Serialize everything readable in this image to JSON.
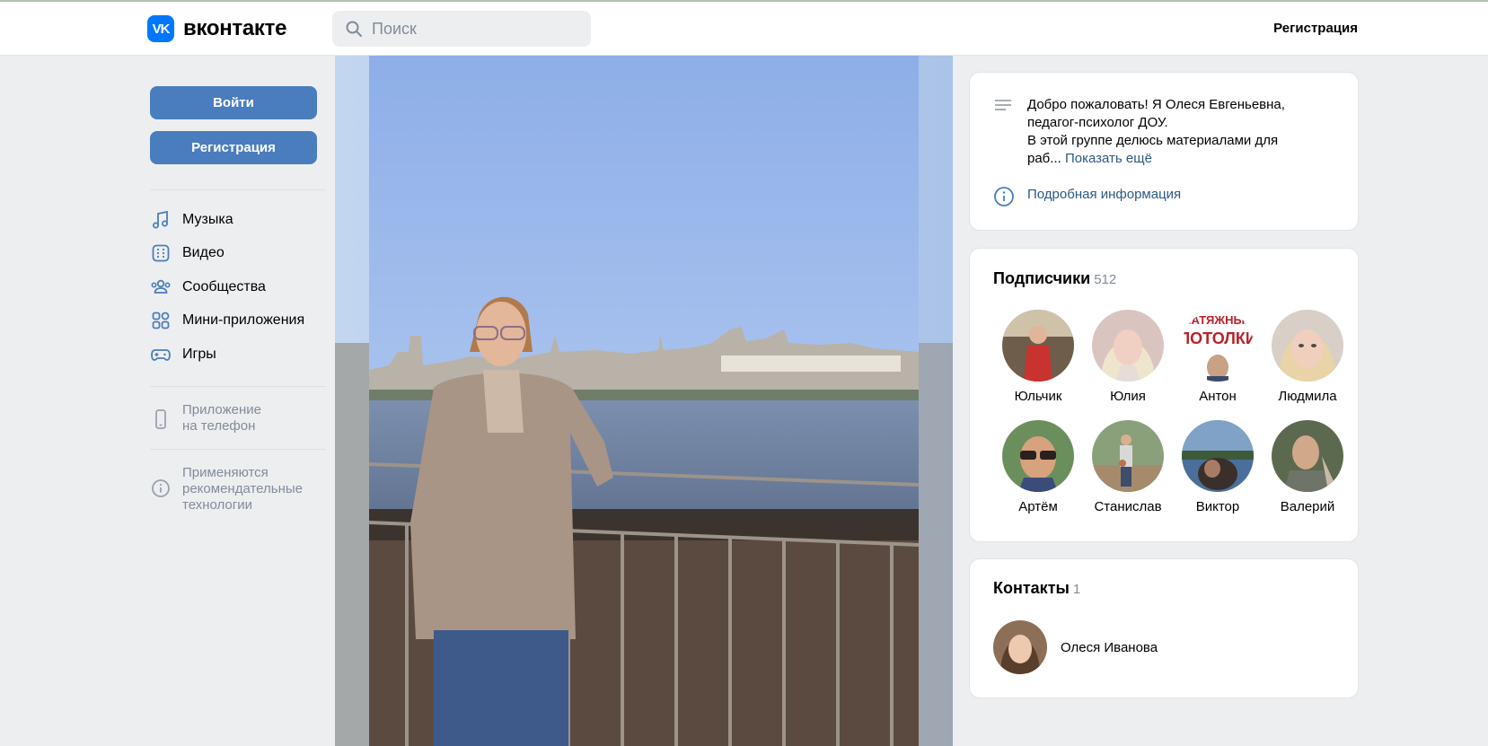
{
  "header": {
    "logo_mark": "VK",
    "logo_text": "вконтакте",
    "search_placeholder": "Поиск",
    "register_link": "Регистрация"
  },
  "sidebar": {
    "login_button": "Войти",
    "register_button": "Регистрация",
    "menu": [
      {
        "label": "Музыка",
        "icon": "music-icon"
      },
      {
        "label": "Видео",
        "icon": "video-icon"
      },
      {
        "label": "Сообщества",
        "icon": "communities-icon"
      },
      {
        "label": "Мини-приложения",
        "icon": "mini-apps-icon"
      },
      {
        "label": "Игры",
        "icon": "games-icon"
      }
    ],
    "app_line1": "Приложение",
    "app_line2": "на телефон",
    "rec_line1": "Применяются",
    "rec_line2": "рекомендательные",
    "rec_line3": "технологии"
  },
  "info": {
    "line1": "Добро пожаловать! Я Олеся Евгеньевна,",
    "line2": "педагог-психолог ДОУ.",
    "line3": "В этой группе делюсь материалами для",
    "line4": "раб...",
    "show_more": "Показать ещё",
    "details": "Подробная информация"
  },
  "subscribers": {
    "title": "Подписчики",
    "count": "512",
    "items": [
      {
        "name": "Юльчик"
      },
      {
        "name": "Юлия"
      },
      {
        "name": "Антон"
      },
      {
        "name": "Людмила"
      },
      {
        "name": "Артём"
      },
      {
        "name": "Станислав"
      },
      {
        "name": "Виктор"
      },
      {
        "name": "Валерий"
      }
    ],
    "avatar_overlay_text": [
      "НАТЯЖНЫЕ",
      "ПОТОЛКИ"
    ]
  },
  "contacts": {
    "title": "Контакты",
    "count": "1",
    "name": "Олеся Иванова"
  },
  "colors": {
    "accent": "#4a7dbd",
    "link": "#2a5885",
    "vk_blue": "#0077ff",
    "muted": "#818c99",
    "background": "#edeef0"
  }
}
